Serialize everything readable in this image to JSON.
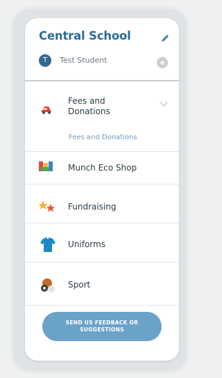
{
  "header": {
    "school_name": "Central School",
    "student_initial": "T",
    "student_name": "Test Student"
  },
  "menu": {
    "fees": {
      "label": "Fees and Donations",
      "sub_item": "Fees and Donations"
    },
    "items": [
      {
        "label": "Munch Eco Shop",
        "icon": "shop-icon"
      },
      {
        "label": "Fundraising",
        "icon": "stars-icon"
      },
      {
        "label": "Uniforms",
        "icon": "shirt-icon"
      },
      {
        "label": "Sport",
        "icon": "sport-icon"
      }
    ]
  },
  "feedback_button": {
    "label": "SEND US FEEDBACK OR SUGGESTIONS"
  },
  "colors": {
    "primary": "#2d6d97",
    "button": "#6aa2c8",
    "text": "#2b3c46"
  }
}
